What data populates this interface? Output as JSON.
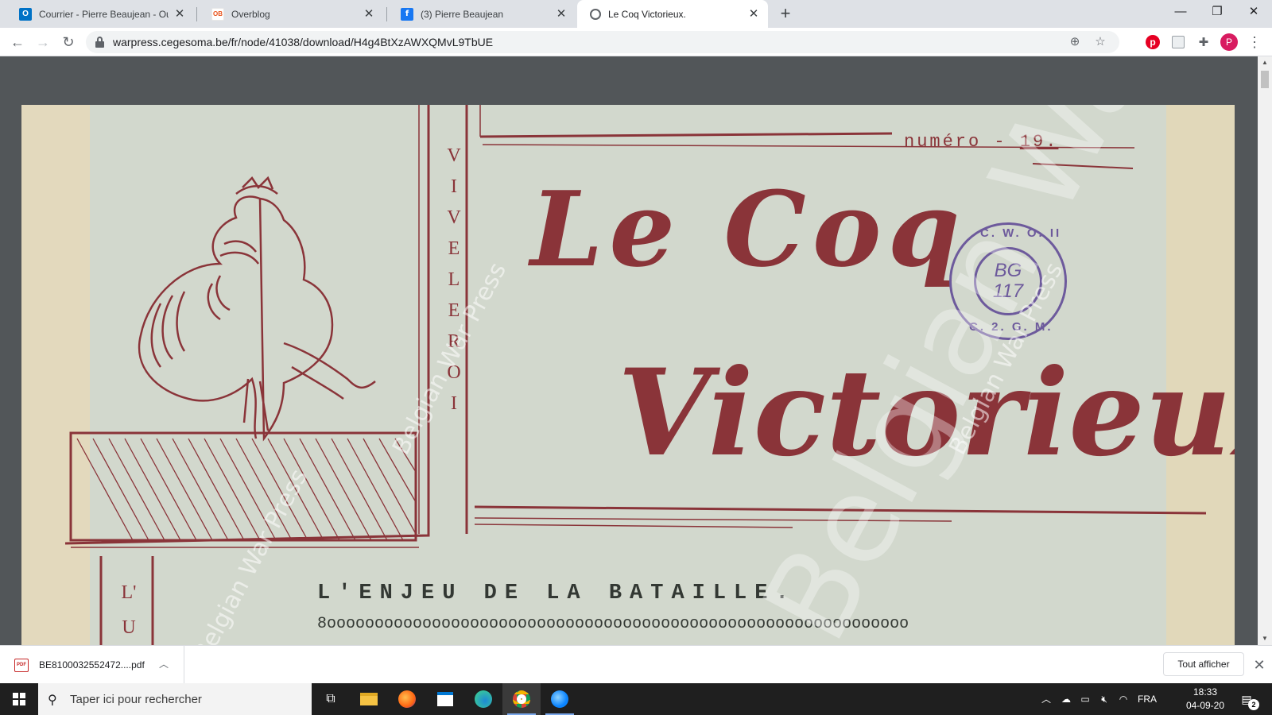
{
  "browser": {
    "tabs": [
      {
        "title": "Courrier - Pierre Beaujean - Outlo",
        "icon": "outlook-icon",
        "active": false
      },
      {
        "title": "Overblog",
        "icon": "overblog-icon",
        "active": false
      },
      {
        "title": "(3) Pierre Beaujean",
        "icon": "facebook-icon",
        "active": false
      },
      {
        "title": "Le Coq Victorieux.",
        "icon": "globe-icon",
        "active": true
      }
    ],
    "new_tab_label": "+",
    "url": "warpress.cegesoma.be/fr/node/41038/download/H4g4BtXzAWXQMvL9TbUE",
    "profile_initial": "P",
    "extensions": [
      "pinterest-icon",
      "extension-icon",
      "puzzle-icon"
    ]
  },
  "document": {
    "masthead": {
      "title_line1": "Le Coq",
      "title_line2": "Victorieux.",
      "numero": "numéro",
      "number": "19.",
      "vertical_motto": [
        "V",
        "I",
        "V",
        "E",
        "L",
        "E",
        "R",
        "O",
        "I"
      ],
      "margin_letters": [
        "L'",
        "U"
      ],
      "stamp": {
        "top": "C. W. O. II",
        "center_line1": "BG",
        "center_line2": "117",
        "bottom": "C. 2. G. M."
      }
    },
    "headline": "L'ENJEU DE LA BATAILLE.",
    "rule": "8ooooooooooooooooooooooooooooooooooooooooooooooooooooooooooooo",
    "watermark": "Belgian War Press"
  },
  "download_shelf": {
    "file_name": "BE8100032552472....pdf",
    "file_type": "PDF",
    "show_all_label": "Tout afficher"
  },
  "taskbar": {
    "search_placeholder": "Taper ici pour rechercher",
    "language": "FRA",
    "time": "18:33",
    "date": "04-09-20",
    "notification_count": "2"
  },
  "colors": {
    "ink_red": "#8a3439",
    "stamp_purple": "#6d5a9c",
    "paper": "#d2d8cd",
    "viewer_bg": "#525659"
  }
}
